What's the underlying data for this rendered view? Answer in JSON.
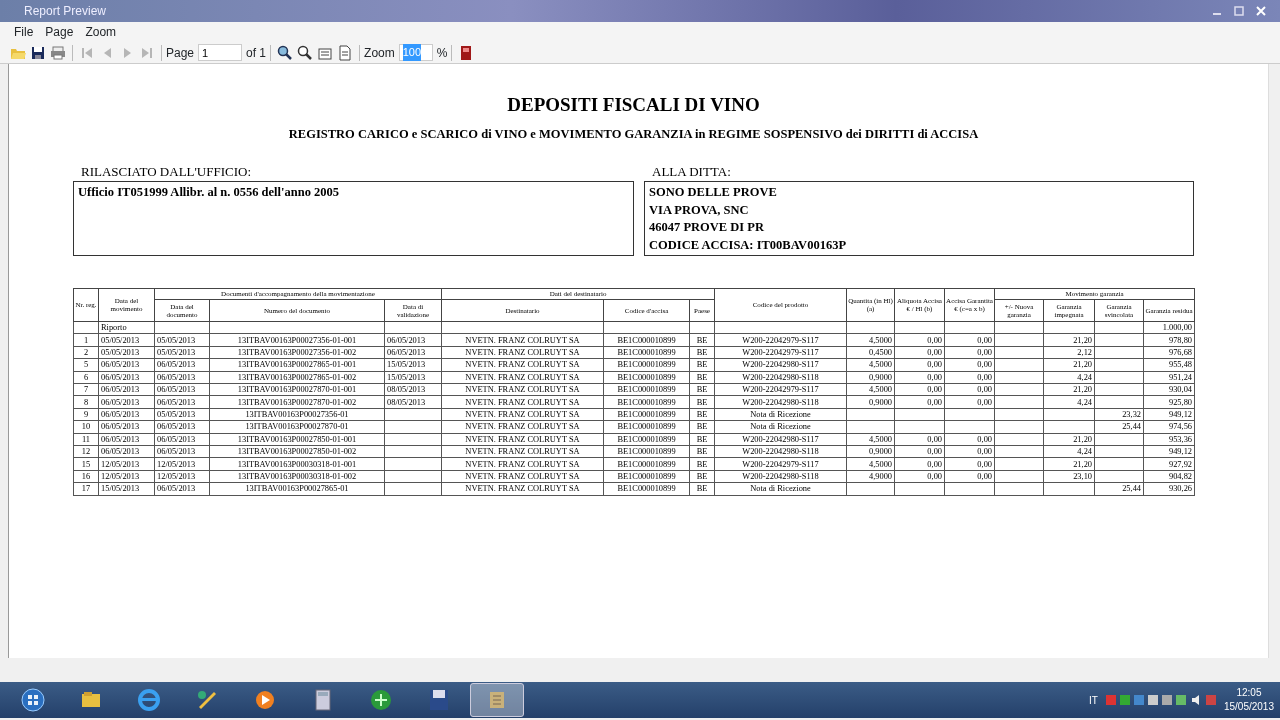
{
  "window": {
    "title": "Report Preview"
  },
  "menu": [
    {
      "label": "File"
    },
    {
      "label": "Page"
    },
    {
      "label": "Zoom"
    }
  ],
  "toolbar": {
    "file_buttons": [
      {
        "kind": "open",
        "disabled": false
      },
      {
        "kind": "save",
        "disabled": false
      },
      {
        "kind": "print",
        "disabled": false
      }
    ],
    "nav_buttons": [
      {
        "kind": "first",
        "disabled": true
      },
      {
        "kind": "prev",
        "disabled": true
      },
      {
        "kind": "next",
        "disabled": true
      },
      {
        "kind": "last",
        "disabled": true
      }
    ],
    "page_label": "Page",
    "page_value": "1",
    "page_total": "of 1",
    "zoom_buttons": [
      {
        "kind": "zoom_in",
        "disabled": false
      },
      {
        "kind": "zoom_out",
        "disabled": false
      },
      {
        "kind": "page_width",
        "disabled": false
      },
      {
        "kind": "whole_page",
        "disabled": false
      }
    ],
    "zoom_label": "Zoom",
    "zoom_value": "100",
    "zoom_selected": true,
    "zoom_unit": "%",
    "exit_button": {
      "kind": "exit",
      "disabled": false
    }
  },
  "report": {
    "title": "DEPOSITI FISCALI DI VINO",
    "subtitle": "REGISTRO CARICO e SCARICO di VINO e MOVIMENTO GARANZIA in REGIME SOSPENSIVO dei DIRITTI di ACCISA",
    "office": {
      "label": "RILASCIATO  DALL'UFFICIO:",
      "lines": [
        "Ufficio IT051999 Allibr. al n. 0556 dell'anno 2005"
      ]
    },
    "company": {
      "label": "ALLA  DITTA:",
      "lines": [
        "SONO DELLE PROVE",
        "VIA PROVA, SNC",
        "46047 PROVE DI PR",
        "CODICE  ACCISA:  IT00BAV00163P"
      ]
    },
    "table": {
      "header_rows": [
        [
          {
            "label": "Nr. reg.",
            "rowspan": 2
          },
          {
            "label": "Data del movimento",
            "rowspan": 2
          },
          {
            "label": "Documenti d'accompagnamento della movimentazione",
            "colspan": 3
          },
          {
            "label": "Dati del destinatario",
            "colspan": 3
          },
          {
            "label": "Codice del prodotto",
            "rowspan": 2
          },
          {
            "label": "Quantita (in Hl) (a)",
            "rowspan": 2
          },
          {
            "label": "Aliquota Accisa € / Hl (b)",
            "rowspan": 2
          },
          {
            "label": "Accisa Garantita € (c=a x b)",
            "rowspan": 2
          },
          {
            "label": "Movimento garanzia",
            "colspan": 4
          }
        ],
        [
          {
            "label": "Data del documento"
          },
          {
            "label": "Numero del documento"
          },
          {
            "label": "Data di validazione"
          },
          {
            "label": "Destinatario"
          },
          {
            "label": "Codice d'accisa"
          },
          {
            "label": "Paese"
          },
          {
            "label": "+/- Nuova garanzia"
          },
          {
            "label": "Garanzia impegnata"
          },
          {
            "label": "Garanzia svincolata"
          },
          {
            "label": "Garanzia residua"
          }
        ]
      ],
      "carry_forward": {
        "label": "Riporto",
        "residual": "1.000,00"
      },
      "rows": [
        {
          "cells": [
            "1",
            "05/05/2013",
            "05/05/2013",
            "13ITBAV00163P00027356-01-001",
            "06/05/2013",
            "NVETN. FRANZ COLRUYT SA",
            "BE1C000010899",
            "BE",
            "W200-22042979-S117",
            "4,5000",
            "0,00",
            "0,00",
            null,
            "21,20",
            null,
            "978,80"
          ]
        },
        {
          "cells": [
            "2",
            "05/05/2013",
            "05/05/2013",
            "13ITBAV00163P00027356-01-002",
            "06/05/2013",
            "NVETN. FRANZ COLRUYT SA",
            "BE1C000010899",
            "BE",
            "W200-22042979-S117",
            "0,4500",
            "0,00",
            "0,00",
            null,
            "2,12",
            null,
            "976,68"
          ]
        },
        {
          "cells": [
            "5",
            "06/05/2013",
            "06/05/2013",
            "13ITBAV00163P00027865-01-001",
            "15/05/2013",
            "NVETN. FRANZ COLRUYT SA",
            "BE1C000010899",
            "BE",
            "W200-22042980-S117",
            "4,5000",
            "0,00",
            "0,00",
            null,
            "21,20",
            null,
            "955,48"
          ]
        },
        {
          "cells": [
            "6",
            "06/05/2013",
            "06/05/2013",
            "13ITBAV00163P00027865-01-002",
            "15/05/2013",
            "NVETN. FRANZ COLRUYT SA",
            "BE1C000010899",
            "BE",
            "W200-22042980-S118",
            "0,9000",
            "0,00",
            "0,00",
            null,
            "4,24",
            null,
            "951,24"
          ]
        },
        {
          "cells": [
            "7",
            "06/05/2013",
            "06/05/2013",
            "13ITBAV00163P00027870-01-001",
            "08/05/2013",
            "NVETN. FRANZ COLRUYT SA",
            "BE1C000010899",
            "BE",
            "W200-22042979-S117",
            "4,5000",
            "0,00",
            "0,00",
            null,
            "21,20",
            null,
            "930,04"
          ]
        },
        {
          "cells": [
            "8",
            "06/05/2013",
            "06/05/2013",
            "13ITBAV00163P00027870-01-002",
            "08/05/2013",
            "NVETN. FRANZ COLRUYT SA",
            "BE1C000010899",
            "BE",
            "W200-22042980-S118",
            "0,9000",
            "0,00",
            "0,00",
            null,
            "4,24",
            null,
            "925,80"
          ]
        },
        {
          "cells": [
            "9",
            "06/05/2013",
            "05/05/2013",
            "13ITBAV00163P00027356-01",
            null,
            "NVETN. FRANZ COLRUYT SA",
            "BE1C000010899",
            "BE",
            "Nota di Ricezione",
            null,
            null,
            null,
            null,
            null,
            "23,32",
            "949,12"
          ]
        },
        {
          "cells": [
            "10",
            "06/05/2013",
            "06/05/2013",
            "13ITBAV00163P00027870-01",
            null,
            "NVETN. FRANZ COLRUYT SA",
            "BE1C000010899",
            "BE",
            "Nota di Ricezione",
            null,
            null,
            null,
            null,
            null,
            "25,44",
            "974,56"
          ]
        },
        {
          "cells": [
            "11",
            "06/05/2013",
            "06/05/2013",
            "13ITBAV00163P00027850-01-001",
            null,
            "NVETN. FRANZ COLRUYT SA",
            "BE1C000010899",
            "BE",
            "W200-22042980-S117",
            "4,5000",
            "0,00",
            "0,00",
            null,
            "21,20",
            null,
            "953,36"
          ]
        },
        {
          "cells": [
            "12",
            "06/05/2013",
            "06/05/2013",
            "13ITBAV00163P00027850-01-002",
            null,
            "NVETN. FRANZ COLRUYT SA",
            "BE1C000010899",
            "BE",
            "W200-22042980-S118",
            "0,9000",
            "0,00",
            "0,00",
            null,
            "4,24",
            null,
            "949,12"
          ]
        },
        {
          "cells": [
            "15",
            "12/05/2013",
            "12/05/2013",
            "13ITBAV00163P00030318-01-001",
            null,
            "NVETN. FRANZ COLRUYT SA",
            "BE1C000010899",
            "BE",
            "W200-22042979-S117",
            "4,5000",
            "0,00",
            "0,00",
            null,
            "21,20",
            null,
            "927,92"
          ]
        },
        {
          "cells": [
            "16",
            "12/05/2013",
            "12/05/2013",
            "13ITBAV00163P00030318-01-002",
            null,
            "NVETN. FRANZ COLRUYT SA",
            "BE1C000010899",
            "BE",
            "W200-22042980-S118",
            "4,9000",
            "0,00",
            "0,00",
            null,
            "23,10",
            null,
            "904,82"
          ]
        },
        {
          "cells": [
            "17",
            "15/05/2013",
            "06/05/2013",
            "13ITBAV00163P00027865-01",
            null,
            "NVETN. FRANZ COLRUYT SA",
            "BE1C000010899",
            "BE",
            "Nota di Ricezione",
            null,
            null,
            null,
            null,
            null,
            "25,44",
            "930,26"
          ]
        }
      ]
    }
  },
  "taskbar": {
    "apps": [
      {
        "active": false
      },
      {
        "active": false
      },
      {
        "active": false
      },
      {
        "active": false
      },
      {
        "active": false
      },
      {
        "active": false
      },
      {
        "active": false
      },
      {
        "active": false
      },
      {
        "active": true
      }
    ],
    "language": "IT",
    "time": "12:05",
    "date": "15/05/2013"
  }
}
